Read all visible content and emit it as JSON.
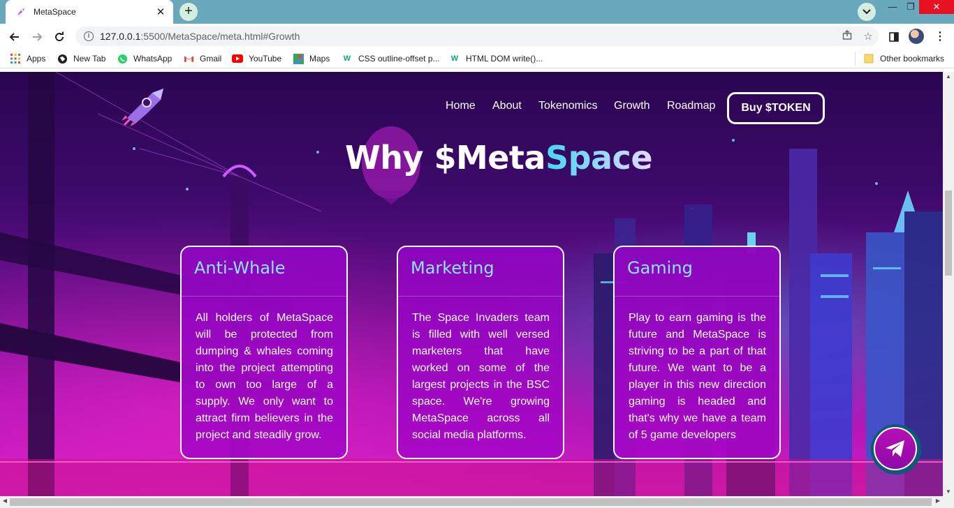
{
  "browser": {
    "tab_title": "MetaSpace",
    "url_host": "127.0.0.1",
    "url_rest": ":5500/MetaSpace/meta.html#Growth",
    "bookmarks": [
      {
        "label": "Apps",
        "icon": "apps-grid-icon"
      },
      {
        "label": "New Tab",
        "icon": "globe-icon"
      },
      {
        "label": "WhatsApp",
        "icon": "whatsapp-icon"
      },
      {
        "label": "Gmail",
        "icon": "gmail-icon"
      },
      {
        "label": "YouTube",
        "icon": "youtube-icon"
      },
      {
        "label": "Maps",
        "icon": "maps-icon"
      },
      {
        "label": "CSS outline-offset p...",
        "icon": "w3schools-icon"
      },
      {
        "label": "HTML DOM write()...",
        "icon": "w3schools-icon"
      }
    ],
    "other_bookmarks": "Other bookmarks"
  },
  "site": {
    "nav": [
      "Home",
      "About",
      "Tokenomics",
      "Growth",
      "Roadmap"
    ],
    "buy_button": "Buy $TOKEN",
    "headline_main": "Why $Meta",
    "headline_accent": "Space",
    "cards": [
      {
        "title": "Anti-Whale",
        "body": "All holders of MetaSpace will be protected from dumping & whales coming into the project attempting to own too large of a supply. We only want to attract firm believers in the project and steadily grow."
      },
      {
        "title": "Marketing",
        "body": "The Space Invaders team is filled with well versed marketers that have worked on some of the largest projects in the BSC space. We're growing MetaSpace across all social media platforms."
      },
      {
        "title": "Gaming",
        "body": "Play to earn gaming is the future and MetaSpace is striving to be a part of that future. We want to be a player in this new direction gaming is headed and that's why we have a team of 5 game developers"
      }
    ]
  },
  "colors": {
    "accent_cyan": "#8fe3f7",
    "tab_bar": "#6aa9bd",
    "card_bg": "#9a08c0"
  }
}
